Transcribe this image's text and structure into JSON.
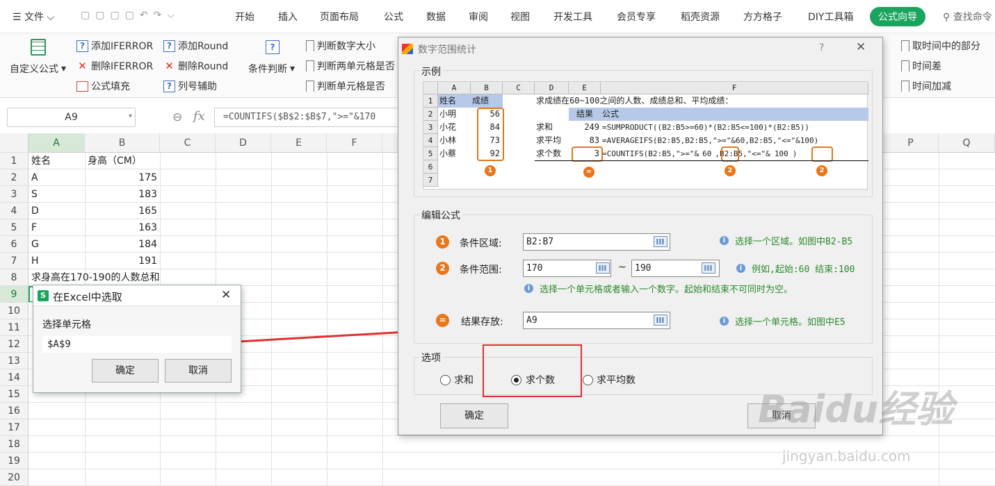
{
  "menubar": {
    "file_label": "文件",
    "tabs": [
      "开始",
      "插入",
      "页面布局",
      "公式",
      "数据",
      "审阅",
      "视图",
      "开发工具",
      "会员专享",
      "稻壳资源",
      "方方格子",
      "DIY工具箱",
      "公式向导"
    ],
    "search_label": "查找命令"
  },
  "ribbon": {
    "custom_formula": "自定义公式",
    "add_iferror": "添加IFERROR",
    "del_iferror": "删除IFERROR",
    "formula_fill": "公式填充",
    "add_round": "添加Round",
    "del_round": "删除Round",
    "col_helper": "列号辅助",
    "cond_judge": "条件判断",
    "judge_num": "判断数字大小",
    "judge_two": "判断两单元格是否",
    "judge_cell": "判断单元格是否",
    "get_time_part": "取时间中的部分",
    "time_diff": "时间差",
    "time_add": "时间加减"
  },
  "formula_bar": {
    "name_box": "A9",
    "fx": "fx",
    "formula": "=COUNTIFS($B$2:$B$7,\">=\"&170"
  },
  "sheet": {
    "columns": [
      "A",
      "B",
      "C",
      "D",
      "E",
      "F",
      "P",
      "Q"
    ],
    "rows": [
      "1",
      "2",
      "3",
      "4",
      "5",
      "6",
      "7",
      "8",
      "9",
      "10",
      "11",
      "12",
      "13",
      "14",
      "15",
      "16",
      "17",
      "18",
      "19",
      "20"
    ],
    "cells": {
      "r1": [
        "姓名",
        "身高（CM）"
      ],
      "r2": [
        "A",
        "175"
      ],
      "r3": [
        "S",
        "183"
      ],
      "r4": [
        "D",
        "165"
      ],
      "r5": [
        "F",
        "163"
      ],
      "r6": [
        "G",
        "184"
      ],
      "r7": [
        "H",
        "191"
      ],
      "r8": [
        "求身高在170-190的人数总和"
      ]
    }
  },
  "select_dialog": {
    "title": "在Excel中选取",
    "label": "选择单元格",
    "value": "$A$9",
    "ok": "确定",
    "cancel": "取消"
  },
  "range_dialog": {
    "title": "数字范围统计",
    "help": "?",
    "example_label": "示例",
    "edit_label": "编辑公式",
    "options_label": "选项",
    "cond_area_label": "条件区域:",
    "cond_area_value": "B2:B7",
    "cond_area_hint": "选择一个区域。如图中B2-B5",
    "cond_range_label": "条件范围:",
    "range_start": "170",
    "range_sep": "~",
    "range_end": "190",
    "range_hint": "例如,起始:60 结束:100",
    "range_hint2": "选择一个单元格或者输入一个数字。起始和结束不可同时为空。",
    "result_label": "结果存放:",
    "result_value": "A9",
    "result_hint": "选择一个单元格。如图中E5",
    "opt_sum": "求和",
    "opt_count": "求个数",
    "opt_avg": "求平均数",
    "selected_option": "求个数",
    "ok": "确定",
    "cancel": "取消",
    "badge1": "1",
    "badge2": "2",
    "badge_eq": "="
  },
  "example": {
    "cols": [
      "A",
      "B",
      "C",
      "D",
      "E",
      "F"
    ],
    "rows": [
      "1",
      "2",
      "3",
      "4",
      "5",
      "6",
      "7"
    ],
    "a": [
      "姓名",
      "小明",
      "小花",
      "小林",
      "小蔡"
    ],
    "b": [
      "成绩",
      "56",
      "84",
      "73",
      "92"
    ],
    "title": "求成绩在60~100之间的人数、成绩总和、平均成绩：",
    "d": [
      "求和",
      "求平均",
      "求个数"
    ],
    "e_head": "结果",
    "f_head": "公式",
    "e": [
      "249",
      "83",
      "3"
    ],
    "f": [
      "=SUMPRODUCT((B2:B5>=60)*(B2:B5<=100)*(B2:B5))",
      "=AVERAGEIFS(B2:B5,B2:B5,\">=\"&60,B2:B5,\"<=\"&100)",
      "=COUNTIFS(B2:B5,\">=\"&",
      "60",
      ",B2:B5,\"<=\"&",
      "100",
      ")"
    ]
  },
  "watermark": {
    "logo": "Baidu经验",
    "url": "jingyan.baidu.com"
  },
  "colors": {
    "accent_green": "#1aa55e",
    "badge_orange": "#e8761a",
    "arrow_red": "#e03030",
    "hint_green": "#2a8a2a"
  }
}
